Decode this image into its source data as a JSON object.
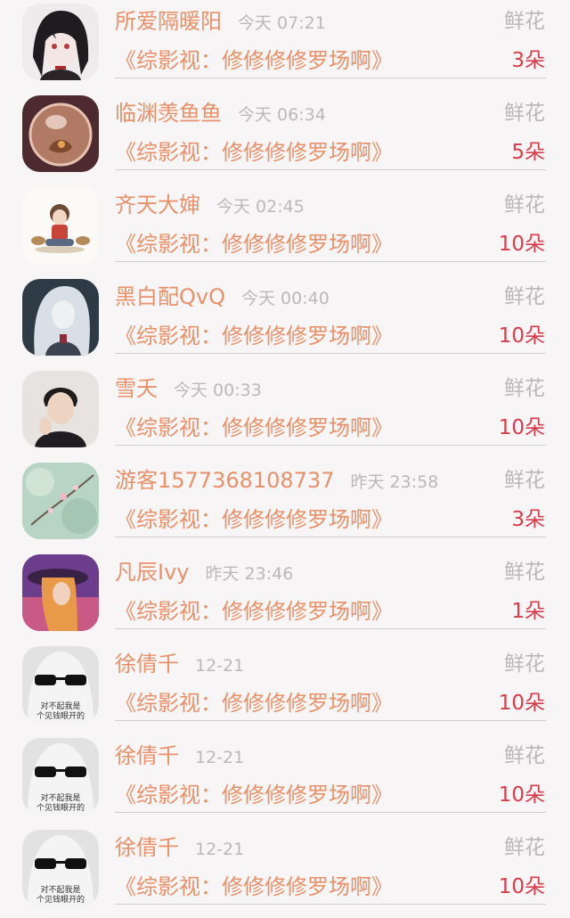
{
  "gift_type": "鲜花",
  "book_title": "《综影视：修修修修罗场啊》",
  "items": [
    {
      "name": "所爱隔暖阳",
      "time": "今天 07:21",
      "count": "3朵",
      "avatar": "avatar-anime-dark-hair"
    },
    {
      "name": "临渊羡鱼鱼",
      "time": "今天 06:34",
      "count": "5朵",
      "avatar": "avatar-glass-sphere"
    },
    {
      "name": "齐天大婶",
      "time": "今天 02:45",
      "count": "10朵",
      "avatar": "avatar-illustrated-child"
    },
    {
      "name": "黑白配QvQ",
      "time": "今天 00:40",
      "count": "10朵",
      "avatar": "avatar-anime-white-hair"
    },
    {
      "name": "雪夭",
      "time": "今天 00:33",
      "count": "10朵",
      "avatar": "avatar-man-portrait"
    },
    {
      "name": "游客1577368108737",
      "time": "昨天 23:58",
      "count": "3朵",
      "avatar": "avatar-blossom"
    },
    {
      "name": "凡辰Ivy",
      "time": "昨天 23:46",
      "count": "1朵",
      "avatar": "avatar-girl-hat"
    },
    {
      "name": "徐倩千",
      "time": "12-21",
      "count": "10朵",
      "avatar": "avatar-ghost-sunglasses",
      "avatar_text": [
        "对不起我是",
        "个见钱眼开的"
      ]
    },
    {
      "name": "徐倩千",
      "time": "12-21",
      "count": "10朵",
      "avatar": "avatar-ghost-sunglasses",
      "avatar_text": [
        "对不起我是",
        "个见钱眼开的"
      ]
    },
    {
      "name": "徐倩千",
      "time": "12-21",
      "count": "10朵",
      "avatar": "avatar-ghost-sunglasses",
      "avatar_text": [
        "对不起我是",
        "个见钱眼开的"
      ]
    }
  ]
}
